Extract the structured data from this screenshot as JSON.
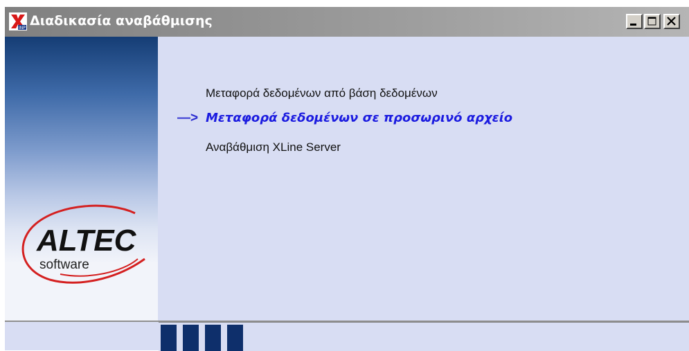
{
  "window": {
    "title": "Διαδικασία αναβάθμισης",
    "app_icon": "app-x-icon",
    "controls": [
      "minimize",
      "maximize",
      "close"
    ]
  },
  "steps": [
    {
      "label": "Μεταφορά δεδομένων  από  βάση δεδομένων",
      "state": "done"
    },
    {
      "label": "Μεταφορά δεδομένων σε προσωρινό αρχείο",
      "state": "current"
    },
    {
      "label": "Αναβάθμιση XLine Server",
      "state": "pending"
    }
  ],
  "current_step_marker": "—>",
  "logo": {
    "brand": "ALTEC",
    "sub": "software"
  },
  "progress": {
    "blocks_filled": 4
  },
  "colors": {
    "current_step": "#1c1ce0",
    "progress": "#0e2f6b",
    "background": "#d8ddf3"
  }
}
